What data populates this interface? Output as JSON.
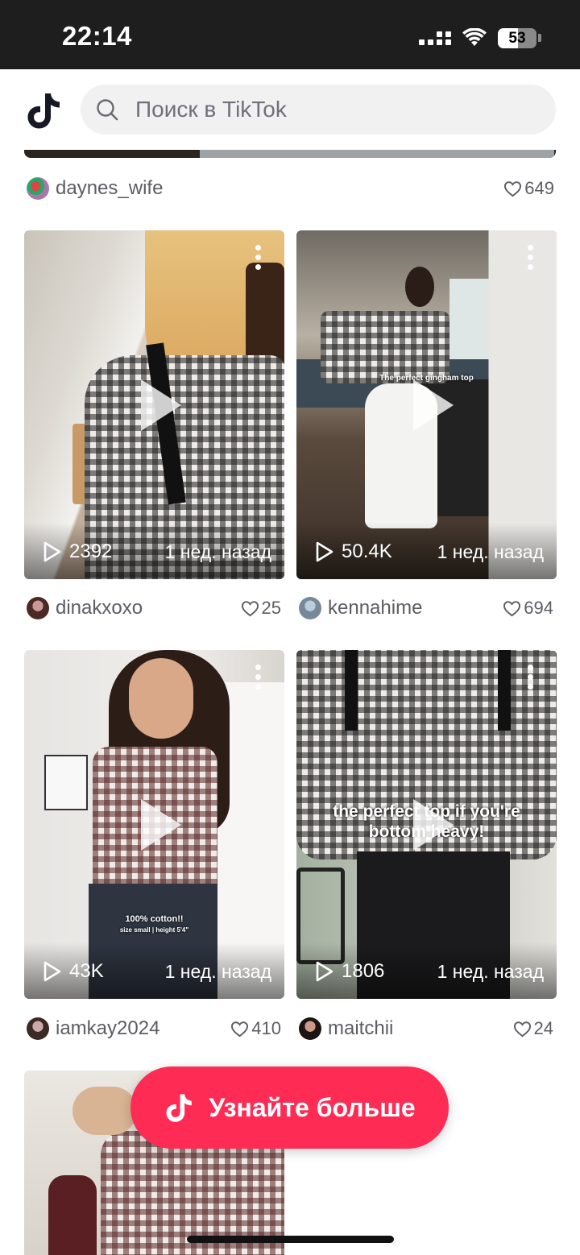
{
  "status_bar": {
    "time": "22:14",
    "battery": "53"
  },
  "search": {
    "placeholder": "Поиск в TikTok"
  },
  "colors": {
    "accent": "#fe2c55",
    "status_bg": "#1e1e1e"
  },
  "top_item": {
    "username": "daynes_wife",
    "likes": "649"
  },
  "videos": [
    {
      "username": "dinakxoxo",
      "likes": "25",
      "views": "2392",
      "date": "1 нед. назад",
      "overlay": ""
    },
    {
      "username": "kennahime",
      "likes": "694",
      "views": "50.4K",
      "date": "1 нед. назад",
      "overlay": "The perfect gingham top"
    },
    {
      "username": "iamkay2024",
      "likes": "410",
      "views": "43K",
      "date": "1 нед. назад",
      "overlay": "100% cotton!!",
      "overlay2": "size small | height 5'4\""
    },
    {
      "username": "maitchii",
      "likes": "24",
      "views": "1806",
      "date": "1 нед. назад",
      "overlay": "the perfect top if you're bottom heavy!"
    }
  ],
  "cta": {
    "label": "Узнайте больше"
  },
  "icons": [
    "tiktok-logo-icon",
    "search-icon",
    "heart-icon",
    "play-icon",
    "more-vertical-icon",
    "wifi-icon",
    "signal-icon",
    "battery-icon"
  ]
}
